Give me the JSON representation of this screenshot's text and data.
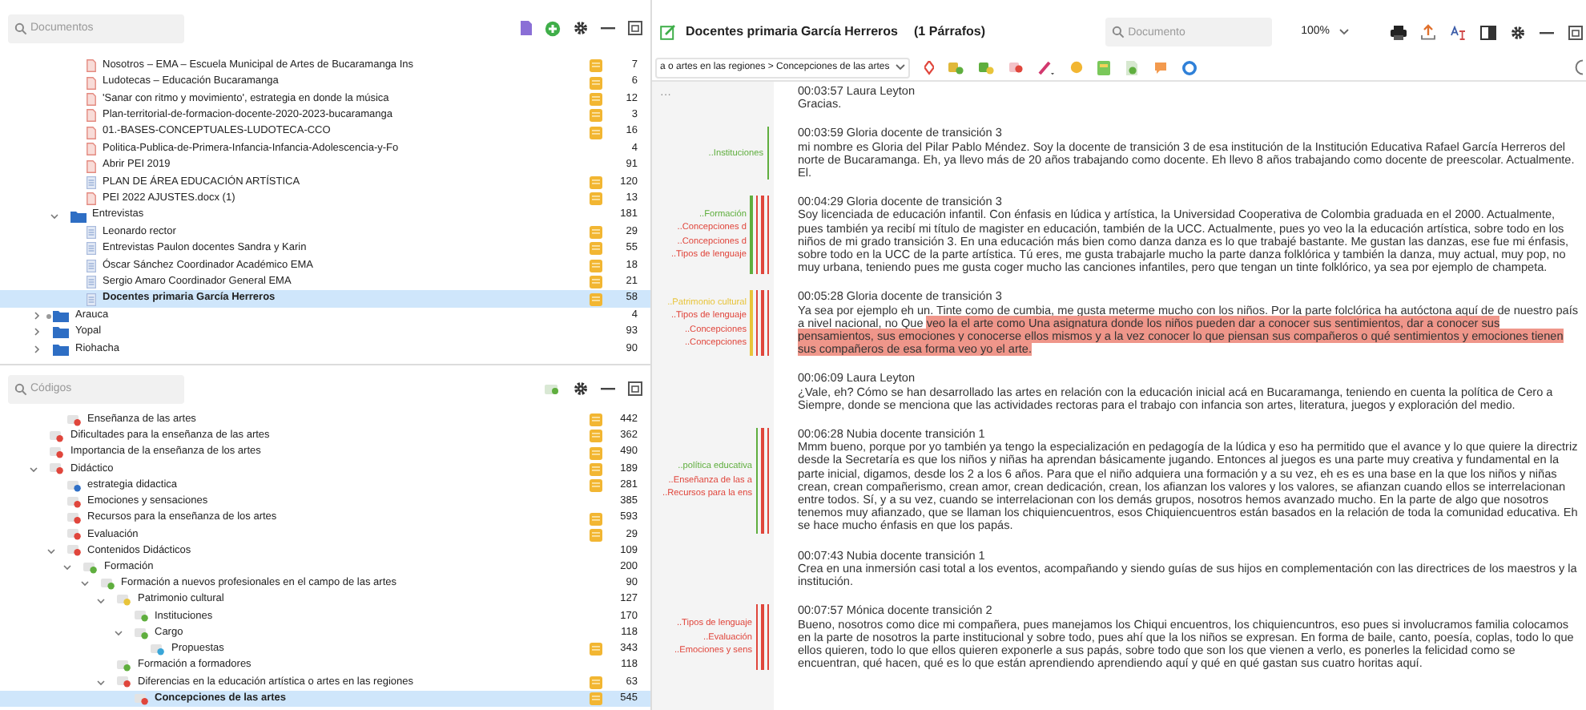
{
  "documents_panel": {
    "search": {
      "placeholder": "Documentos"
    },
    "tree": [
      {
        "children": [
          {
            "children": [
              {
                "label": "Nosotros – EMA – Escuela Municipal de Artes de Bucaramanga Ins",
                "kind": "pdf",
                "selected": false,
                "memo": true,
                "count": "7"
              },
              {
                "label": "Ludotecas – Educación Bucaramanga",
                "kind": "pdf",
                "selected": false,
                "memo": true,
                "count": "6"
              },
              {
                "label": "'Sanar con ritmo y movimiento', estrategia en donde la música",
                "kind": "pdf",
                "selected": false,
                "memo": true,
                "count": "12"
              },
              {
                "label": "Plan-territorial-de-formacion-docente-2020-2023-bucaramanga",
                "kind": "pdf",
                "selected": false,
                "memo": true,
                "count": "3"
              },
              {
                "label": "01.-BASES-CONCEPTUALES-LUDOTECA-CCO",
                "kind": "pdf",
                "selected": false,
                "memo": true,
                "count": "16"
              },
              {
                "label": "Politica-Publica-de-Primera-Infancia-Infancia-Adolescencia-y-Fo",
                "kind": "pdf",
                "selected": false,
                "memo": false,
                "count": "4"
              },
              {
                "label": "Abrir PEI 2019",
                "kind": "pdf",
                "selected": false,
                "memo": false,
                "count": "91"
              },
              {
                "label": "PLAN DE ÁREA EDUCACIÓN ARTÍSTICA",
                "kind": "text",
                "selected": false,
                "memo": true,
                "count": "120"
              },
              {
                "label": "PEI 2022 AJUSTES.docx (1)",
                "kind": "pdf",
                "selected": false,
                "memo": true,
                "count": "13"
              }
            ]
          },
          {
            "label": "Entrevistas",
            "kind": "folder",
            "expanded": true,
            "flag": false,
            "selected": false,
            "memo": false,
            "count": "181",
            "children": [
              {
                "label": "Leonardo rector",
                "kind": "text",
                "selected": false,
                "memo": true,
                "count": "29"
              },
              {
                "label": "Entrevistas Paulon docentes Sandra y Karin",
                "kind": "text",
                "selected": false,
                "memo": true,
                "count": "55"
              },
              {
                "label": "Óscar Sánchez Coordinador Académico EMA",
                "kind": "text",
                "selected": false,
                "memo": true,
                "count": "18"
              },
              {
                "label": "Sergio Amaro Coordinador General EMA",
                "kind": "text",
                "selected": false,
                "memo": true,
                "count": "21"
              },
              {
                "label": "Docentes primaria García Herreros",
                "kind": "text",
                "selected": true,
                "memo": true,
                "count": "58"
              }
            ]
          }
        ]
      },
      {
        "label": "Arauca",
        "kind": "folder",
        "expanded": false,
        "flag": true,
        "selected": false,
        "memo": false,
        "count": "4"
      },
      {
        "label": "Yopal",
        "kind": "folder",
        "expanded": false,
        "flag": false,
        "selected": false,
        "memo": false,
        "count": "93"
      },
      {
        "label": "Riohacha",
        "kind": "folder",
        "expanded": false,
        "flag": false,
        "selected": false,
        "memo": false,
        "count": "90"
      }
    ]
  },
  "codes_panel": {
    "search": {
      "placeholder": "Códigos"
    },
    "tree": [
      {
        "children": [
          {
            "children": [
              {
                "label": "Enseñanza de las artes",
                "color": "#e0463c",
                "selected": false,
                "memo": true,
                "count": "442"
              }
            ]
          },
          {
            "label": "Dificultades para la enseñanza de las artes",
            "color": "#e0463c",
            "selected": false,
            "memo": true,
            "count": "362"
          },
          {
            "label": "Importancia de la enseñanza de los artes",
            "color": "#e0463c",
            "selected": false,
            "memo": true,
            "count": "490"
          },
          {
            "label": "Didáctico",
            "color": "#e0463c",
            "expanded": true,
            "selected": false,
            "memo": true,
            "count": "189",
            "children": [
              {
                "label": "estrategia didactica",
                "color": "#2f6fc6",
                "selected": false,
                "memo": true,
                "count": "281"
              },
              {
                "label": "Emociones y sensaciones",
                "color": "#e0463c",
                "selected": false,
                "memo": false,
                "count": "385"
              },
              {
                "label": "Recursos para la enseñanza de los artes",
                "color": "#e0463c",
                "selected": false,
                "memo": true,
                "count": "593"
              },
              {
                "label": "Evaluación",
                "color": "#e0463c",
                "selected": false,
                "memo": true,
                "count": "29"
              },
              {
                "label": "Contenidos Didácticos",
                "color": "#e0463c",
                "expanded": true,
                "selected": false,
                "memo": false,
                "count": "109",
                "children": [
                  {
                    "label": "Formación",
                    "color": "#5fae3e",
                    "expanded": true,
                    "selected": false,
                    "memo": false,
                    "count": "200",
                    "children": [
                      {
                        "label": "Formación a nuevos profesionales en el campo de las artes",
                        "color": "#5fae3e",
                        "expanded": true,
                        "selected": false,
                        "memo": false,
                        "count": "90",
                        "children": [
                          {
                            "label": "Patrimonio cultural",
                            "color": "#e8c43a",
                            "expanded": true,
                            "selected": false,
                            "memo": false,
                            "count": "127",
                            "children": [
                              {
                                "label": "Instituciones",
                                "color": "#5fae3e",
                                "selected": false,
                                "memo": false,
                                "count": "170"
                              },
                              {
                                "label": "Cargo",
                                "color": "#5fae3e",
                                "expanded": true,
                                "selected": false,
                                "memo": false,
                                "count": "118",
                                "children": [
                                  {
                                    "label": "Propuestas",
                                    "color": "#3aa6d8",
                                    "selected": false,
                                    "memo": true,
                                    "count": "343"
                                  }
                                ]
                              }
                            ]
                          },
                          {
                            "label": "Formación a formadores",
                            "color": "#5fae3e",
                            "selected": false,
                            "memo": false,
                            "count": "118"
                          },
                          {
                            "label": "Diferencias en la educación artística o artes en las regiones",
                            "color": "#e0463c",
                            "expanded": true,
                            "selected": false,
                            "memo": true,
                            "count": "63",
                            "children": [
                              {
                                "label": "Concepciones de las artes",
                                "color": "#e0463c",
                                "selected": true,
                                "memo": true,
                                "count": "545"
                              }
                            ]
                          }
                        ]
                      }
                    ]
                  }
                ]
              }
            ]
          }
        ]
      }
    ]
  },
  "document_browser": {
    "title": "Docentes primaria García Herreros",
    "subtitle": "(1 Párrafos)",
    "search": {
      "placeholder": "Documento"
    },
    "zoom": "100%",
    "breadcrumb": "a o artes en las regiones > Concepciones de las artes",
    "stripe_menu": "···",
    "paragraphs": [
      {
        "speaker": "00:03:57 Laura Leyton",
        "segments": [
          {
            "text": "Gracias."
          }
        ]
      },
      {
        "speaker": "00:03:59 Gloria docente de transición 3",
        "segments": [
          {
            "text": "mi nombre es Gloria del Pilar Pablo Méndez. Soy la docente de transición 3 de esa institución de la Institución Educativa Rafael García Herreros del norte de Bucaramanga. Eh, ya llevo más de 20 años trabajando como docente. Eh llevo 8 años trabajando como docente de preescolar. Actualmente. El."
          }
        ],
        "codings": [
          {
            "label": "..Instituciones",
            "color": "#5fae3e"
          }
        ]
      },
      {
        "speaker": "00:04:29 Gloria docente de transición 3",
        "segments": [
          {
            "text": "Soy licenciada de educación infantil. Con énfasis en lúdica y artística, la Universidad Cooperativa de Colombia graduada en el 2000. Actualmente, pues también ya recibí mi título de magister en educación, también de la UCC. Actualmente, pues yo veo la la educación artística, sobre todo en los niños de mi grado transición 3. En una educación más bien como danza danza es lo que trabajé bastante. Me gustan las danzas, ese fue mi énfasis, sobre todo en la UCC de la parte artística. Tú eres, me gusta trabajarle mucho la parte danza folklórica y también la danza, muy actual, muy pop, no muy urbana, teniendo pues me gusta coger mucho las canciones infantiles, pero que tengan un tinte folklórico, ya sea por ejemplo de champeta."
          }
        ],
        "codings": [
          {
            "label": "..Formación",
            "color": "#5fae3e"
          },
          {
            "label": "..Concepciones d",
            "color": "#e0463c"
          },
          {
            "label": "..Concepciones d",
            "color": "#e0463c"
          },
          {
            "label": "..Tipos de lenguaje",
            "color": "#e0463c"
          }
        ]
      },
      {
        "speaker": "00:05:28 Gloria docente de transición 3",
        "segments": [
          {
            "text": "Ya sea por ejemplo eh un. Tinte como de cumbia, me gusta meterme mucho con los niños. Por la parte folclórica ha autóctona aquí de de nuestro país a nivel nacional, no Que "
          },
          {
            "text": "veo la el arte como Una asignatura donde los niños pueden dar a conocer sus sentimientos, dar a conocer sus pensamientos, sus emociones y conocerse ellos mismos y a la vez conocer lo que piensan sus compañeros o qué sentimientos y emociones tienen sus compañeros de esa forma veo yo el arte.",
            "color": "#ef968a"
          }
        ],
        "codings": [
          {
            "label": "..Patrimonio cultural",
            "color": "#e8c43a"
          },
          {
            "label": "..Tipos de lenguaje",
            "color": "#e0463c"
          },
          {
            "label": "..Concepciones",
            "color": "#e0463c"
          },
          {
            "label": "..Concepciones",
            "color": "#e0463c"
          }
        ]
      },
      {
        "speaker": "00:06:09 Laura Leyton",
        "segments": [
          {
            "text": "¿Vale, eh? Cómo se han desarrollado las artes en relación con la educación inicial acá en Bucaramanga, teniendo en cuenta la política de Cero a Siempre, donde se menciona que las actividades rectoras para el trabajo con infancia son artes, literatura, juegos y exploración del medio."
          }
        ]
      },
      {
        "speaker": "00:06:28 Nubia docente transición 1",
        "segments": [
          {
            "text": "Mmm bueno, porque por yo también ya tengo la especialización en pedagogía de la lúdica y eso ha permitido que el avance y lo que quiere la directriz desde la Secretaría es que los niños y niñas ha aprendan básicamente jugando. Entonces al juegos es una parte muy creativa y fundamental en la parte inicial, digamos, desde los 2 a los 6 años. Para que el niño adquiera una formación y a su vez, eh es es una base en la que los niños y niñas crean, crean compañerismo, crean amor, crean dedicación, crean, los afianzan los valores y los valores, se afianzan cuando ellos se interrelacionan entre todos. Sí, y a su vez, cuando se interrelacionan con los demás grupos, nosotros hemos avanzado mucho. En la parte de algo que nosotros tenemos muy afianzado, que se llaman los chiquiencuentros, esos Chiquiencuentros están basados en la relación de toda la comunidad educativa. Eh se hace mucho énfasis en que los papás."
          }
        ],
        "codings": [
          {
            "label": "..política educativa",
            "color": "#5fae3e"
          },
          {
            "label": "..Enseñanza de las a",
            "color": "#e0463c"
          },
          {
            "label": "..Recursos para la ens",
            "color": "#e0463c"
          }
        ]
      },
      {
        "speaker": "00:07:43 Nubia docente transición 1",
        "segments": [
          {
            "text": "Crea en una inmersión casi total a los eventos, acompañando y siendo guías de sus hijos en complementación con las directrices de los maestros y la institución."
          }
        ]
      },
      {
        "speaker": "00:07:57 Mónica docente transición 2",
        "segments": [
          {
            "text": "Bueno, nosotros como dice mi compañera, pues manejamos los Chiqui encuentros, los chiquiencuntros, eso pues si involucramos familia colocamos en la parte de nosotros la parte institucional y sobre todo, pues ahí que la los niños se expresan. En forma de baile, canto, poesía, coplas, todo lo que ellos quieren, todo lo que ellos quieren exponerle a sus papás, sobre todo que son los que vienen a verlo, es ponerles la felicidad como se encuentran, qué hacen, qué es lo que están aprendiendo aprendiendo aquí y qué en qué gastan sus cuatro horitas aquí."
          }
        ],
        "codings": [
          {
            "label": "..Tipos de lenguaje",
            "color": "#e0463c"
          },
          {
            "label": "..Evaluación",
            "color": "#e0463c"
          },
          {
            "label": "..Emociones y sens",
            "color": "#e0463c"
          }
        ]
      }
    ]
  }
}
